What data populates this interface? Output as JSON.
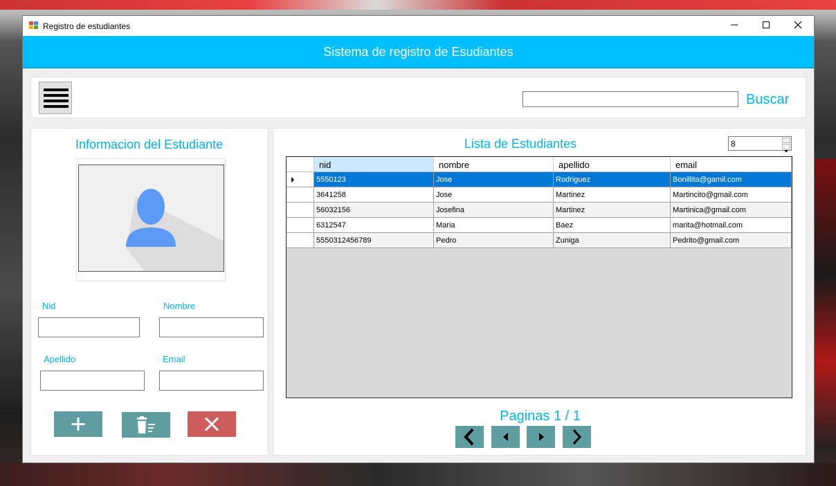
{
  "window": {
    "title": "Registro de estudiantes",
    "controls": {
      "minimize": "—",
      "maximize": "☐",
      "close": "✕"
    }
  },
  "header": {
    "title": "Sistema de registro de Esudiantes"
  },
  "toolbar": {
    "menu_icon": "hamburger-icon",
    "search_value": "",
    "search_label": "Buscar"
  },
  "student_info": {
    "heading": "Informacion del Estudiante",
    "photo_icon": "user-avatar-icon",
    "fields": {
      "nid": {
        "label": "Nid",
        "value": ""
      },
      "nombre": {
        "label": "Nombre",
        "value": ""
      },
      "apellido": {
        "label": "Apellido",
        "value": ""
      },
      "email": {
        "label": "Email",
        "value": ""
      }
    },
    "actions": [
      {
        "name": "add",
        "icon": "plus-icon",
        "color": "#5f9ea0"
      },
      {
        "name": "delete",
        "icon": "trash-icon",
        "color": "#5f9ea0"
      },
      {
        "name": "cancel",
        "icon": "close-icon",
        "color": "#cd5c5c"
      }
    ]
  },
  "student_list": {
    "heading": "Lista de Estudiantes",
    "page_size": "8",
    "columns": [
      "nid",
      "nombre",
      "apellido",
      "email"
    ],
    "rows": [
      [
        "5550123",
        "Jose",
        "Rodriguez",
        "Bonillita@gamil.com"
      ],
      [
        "3641258",
        "Jose",
        "Martinez",
        "Martincito@gmail.com"
      ],
      [
        "56032156",
        "Josefina",
        "Martinez",
        "Martinica@gmail.com"
      ],
      [
        "6312547",
        "Maria",
        "Baez",
        "marita@hotmail.com"
      ],
      [
        "5550312456789",
        "Pedro",
        "Zuniga",
        "Pedrito@gmail.com"
      ]
    ],
    "selected_row": 0,
    "pager": "Paginas 1 / 1",
    "nav": [
      "first-page-icon",
      "prev-page-icon",
      "next-page-icon",
      "last-page-icon"
    ]
  },
  "colors": {
    "accent": "#00bfff",
    "accent_text": "#00b4e6",
    "button": "#5f9ea0",
    "danger": "#cd5c5c",
    "selection": "#0078d7"
  }
}
